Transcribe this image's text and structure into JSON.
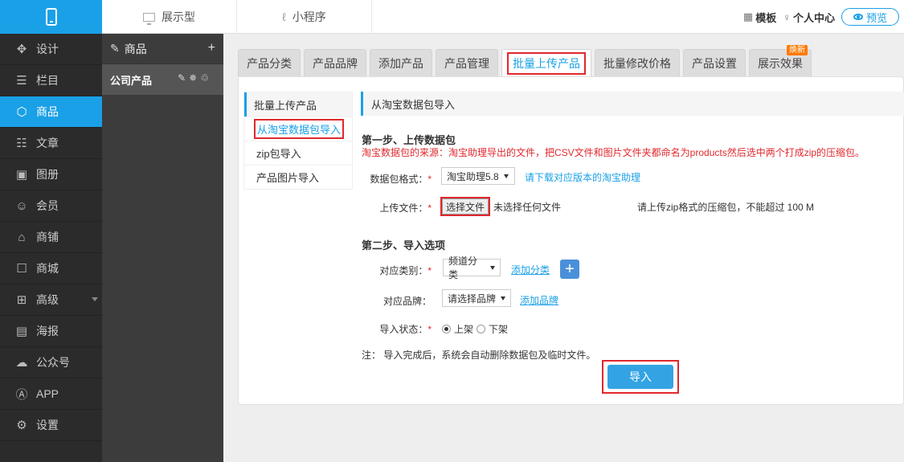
{
  "topbar": {
    "tab_display": "展示型",
    "tab_miniprogram": "小程序",
    "template_label": "模板",
    "personal_label": "个人中心",
    "preview_label": "预览"
  },
  "sidebar": {
    "items": [
      {
        "label": "设计",
        "icon": "design-icon"
      },
      {
        "label": "栏目",
        "icon": "list-icon"
      },
      {
        "label": "商品",
        "icon": "cube-icon"
      },
      {
        "label": "文章",
        "icon": "article-icon"
      },
      {
        "label": "图册",
        "icon": "image-icon"
      },
      {
        "label": "会员",
        "icon": "user-icon"
      },
      {
        "label": "商铺",
        "icon": "shop-icon"
      },
      {
        "label": "商城",
        "icon": "mall-icon"
      },
      {
        "label": "高级",
        "icon": "grid-icon"
      },
      {
        "label": "海报",
        "icon": "poster-icon"
      },
      {
        "label": "公众号",
        "icon": "wechat-icon"
      },
      {
        "label": "APP",
        "icon": "app-icon"
      },
      {
        "label": "设置",
        "icon": "settings-icon"
      }
    ],
    "active_index": 2
  },
  "panel2": {
    "title": "商品",
    "add": "+",
    "item": "公司产品"
  },
  "tabs": [
    "产品分类",
    "产品品牌",
    "添加产品",
    "产品管理",
    "批量上传产品",
    "批量修改价格",
    "产品设置",
    "展示效果"
  ],
  "active_tab": "批量上传产品",
  "new_badge": "焕新",
  "left_nav": {
    "head": "批量上传产品",
    "items": [
      "从淘宝数据包导入",
      "zip包导入",
      "产品图片导入"
    ]
  },
  "section_title": "从淘宝数据包导入",
  "step1": {
    "title": "第一步、上传数据包",
    "note": "淘宝数据包的来源：淘宝助理导出的文件，把CSV文件和图片文件夹都命名为products然后选中两个打成zip的压缩包。",
    "format_label": "数据包格式：",
    "format_value": "淘宝助理5.8",
    "download_link": "请下载对应版本的淘宝助理",
    "file_label": "上传文件：",
    "file_button": "选择文件",
    "file_status": "未选择任何文件",
    "file_hint": "请上传zip格式的压缩包，不能超过 100 M"
  },
  "step2": {
    "title": "第二步、导入选项",
    "category_label": "对应类别：",
    "category_value": "频道分类",
    "add_category": "添加分类",
    "brand_label": "对应品牌：",
    "brand_value": "请选择品牌",
    "add_brand": "添加品牌",
    "status_label": "导入状态：",
    "status_on": "上架",
    "status_off": "下架"
  },
  "footnote": "注： 导入完成后，系统会自动删除数据包及临时文件。",
  "import_button": "导入",
  "colors": {
    "accent": "#1aa0e6",
    "highlight": "#e0282d",
    "sidebar": "#2b2b2b"
  }
}
